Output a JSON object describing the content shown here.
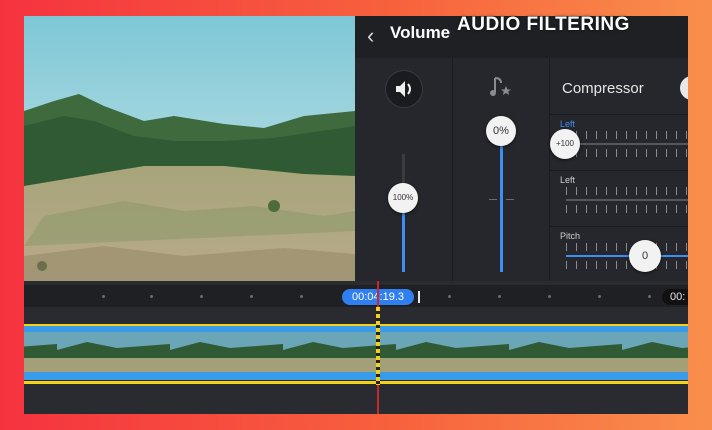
{
  "overlay": {
    "badge": "AUDIO FILTERING"
  },
  "panel": {
    "title": "Volume",
    "back_icon": "chevron-left-icon",
    "volume": {
      "icon": "speaker-icon",
      "value_label": "100%",
      "value": 100
    },
    "effects": {
      "icon": "music-note-star-icon",
      "value_label": "0%",
      "value": 0
    },
    "compressor": {
      "label": "Compressor",
      "rows": [
        {
          "label": "Left",
          "knob_label": "+100",
          "value": -100
        },
        {
          "label": "Left"
        }
      ],
      "pitch": {
        "label": "Pitch",
        "value_label": "0",
        "value": 0
      }
    }
  },
  "timeline": {
    "current_time": "00:04:19.3",
    "end_time": "00:"
  },
  "colors": {
    "accent": "#3b8ff2",
    "playhead": "#c9272a",
    "audio_line": "#f2d21a",
    "border_gradient_start": "#f5333f",
    "border_gradient_end": "#f98f4c"
  }
}
